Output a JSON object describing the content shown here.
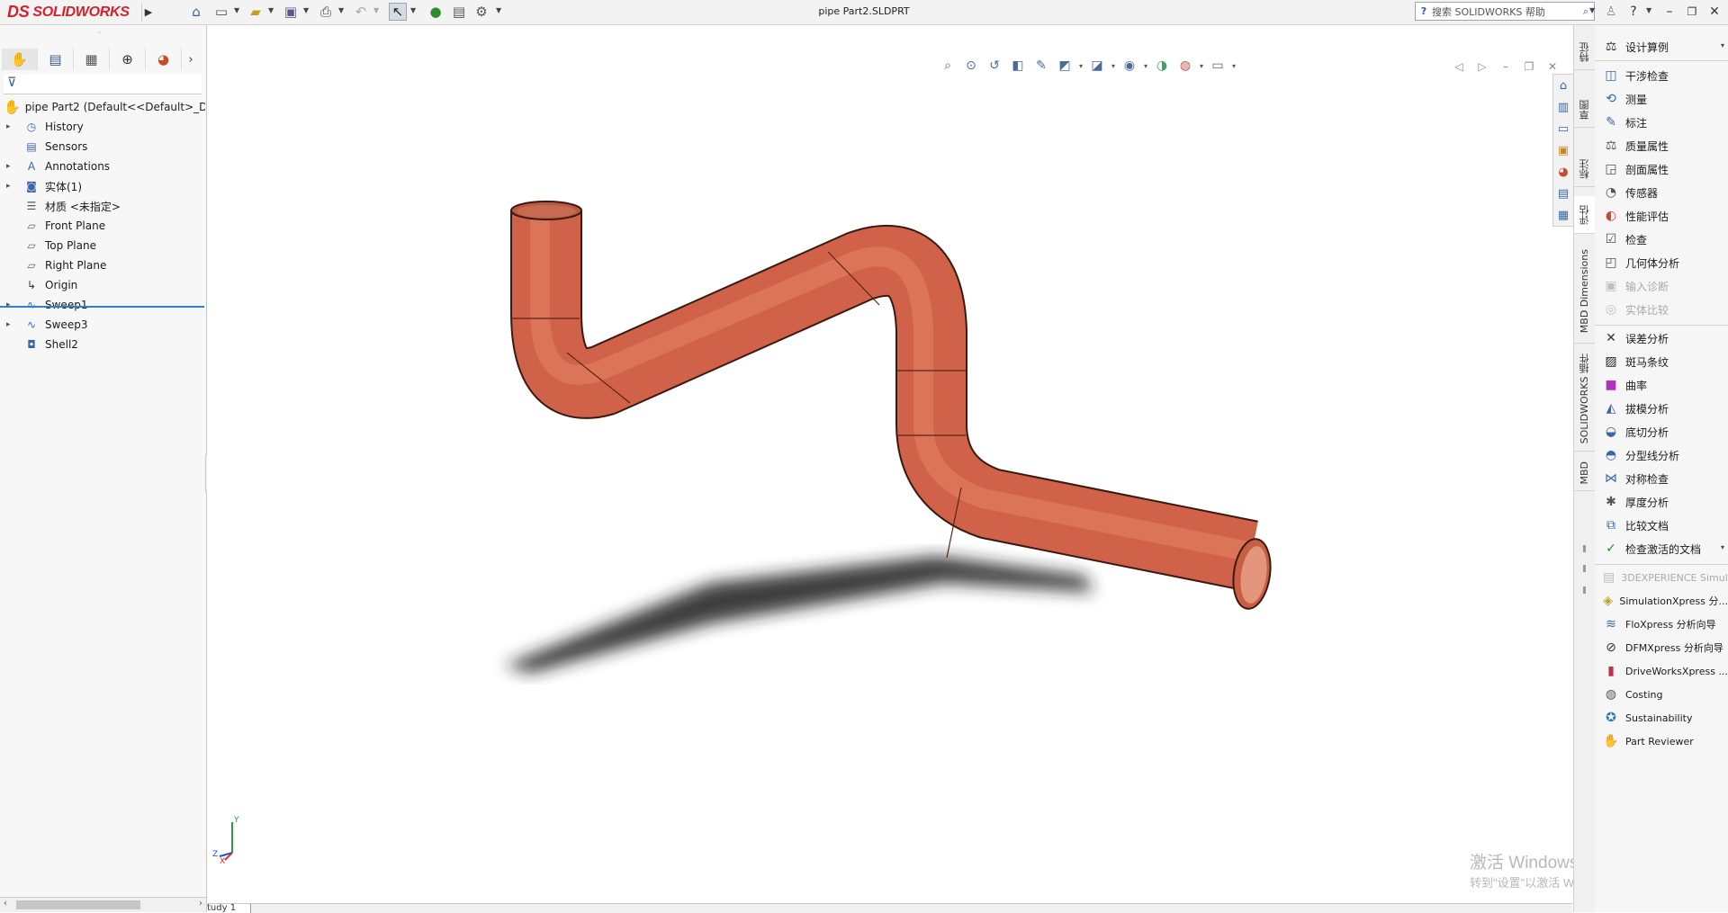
{
  "app": {
    "brand": "SOLIDWORKS",
    "brand_prefix": "DS",
    "document_title": "pipe Part2.SLDPRT",
    "help_search_placeholder": "搜索 SOLIDWORKS 帮助",
    "accent_color": "#d6202a",
    "pipe_color": "#d4674b"
  },
  "toolbar": {
    "icons": [
      "home-icon",
      "new-document-icon",
      "open-icon",
      "save-icon",
      "print-icon",
      "undo-icon",
      "select-icon",
      "rebuild-icon",
      "file-properties-icon",
      "options-icon"
    ]
  },
  "feature_tree": {
    "root_label": "pipe Part2  (Default<<Default>_Di",
    "items": [
      {
        "label": "History",
        "icon": "history-icon",
        "expandable": true
      },
      {
        "label": "Sensors",
        "icon": "sensors-icon",
        "expandable": false
      },
      {
        "label": "Annotations",
        "icon": "annotations-icon",
        "expandable": true
      },
      {
        "label": "实体(1)",
        "icon": "solid-bodies-icon",
        "expandable": true
      },
      {
        "label": "材质 <未指定>",
        "icon": "material-icon",
        "expandable": false
      },
      {
        "label": "Front Plane",
        "icon": "plane-icon",
        "expandable": false
      },
      {
        "label": "Top Plane",
        "icon": "plane-icon",
        "expandable": false
      },
      {
        "label": "Right Plane",
        "icon": "plane-icon",
        "expandable": false
      },
      {
        "label": "Origin",
        "icon": "origin-icon",
        "expandable": false
      },
      {
        "label": "Sweep1",
        "icon": "sweep-icon",
        "expandable": true
      },
      {
        "label": "Sweep3",
        "icon": "sweep-icon",
        "expandable": true
      },
      {
        "label": "Shell2",
        "icon": "shell-icon",
        "expandable": false
      }
    ]
  },
  "vertical_tabs": [
    {
      "label": "特征"
    },
    {
      "label": "草图"
    },
    {
      "label": "标注"
    },
    {
      "label": "评估",
      "active": true
    },
    {
      "label": "MBD Dimensions"
    },
    {
      "label": "SOLIDWORKS 插件"
    },
    {
      "label": "MBD"
    }
  ],
  "evaluate_panel": {
    "items": [
      {
        "label": "设计算例",
        "icon": "design-study-icon",
        "dropdown": true
      },
      {
        "label": "干涉检查",
        "icon": "interference-check-icon"
      },
      {
        "label": "测量",
        "icon": "measure-icon"
      },
      {
        "label": "标注",
        "icon": "markup-icon"
      },
      {
        "label": "质量属性",
        "icon": "mass-properties-icon"
      },
      {
        "label": "剖面属性",
        "icon": "section-properties-icon"
      },
      {
        "label": "传感器",
        "icon": "sensor-icon"
      },
      {
        "label": "性能评估",
        "icon": "performance-evaluation-icon"
      },
      {
        "label": "检查",
        "icon": "check-icon"
      },
      {
        "label": "几何体分析",
        "icon": "geometry-analysis-icon"
      },
      {
        "label": "输入诊断",
        "icon": "import-diagnostics-icon",
        "disabled": true
      },
      {
        "label": "实体比较",
        "icon": "compare-bodies-icon",
        "disabled": true
      },
      {
        "label": "误差分析",
        "icon": "deviation-analysis-icon"
      },
      {
        "label": "斑马条纹",
        "icon": "zebra-stripes-icon"
      },
      {
        "label": "曲率",
        "icon": "curvature-icon"
      },
      {
        "label": "拔模分析",
        "icon": "draft-analysis-icon"
      },
      {
        "label": "底切分析",
        "icon": "undercut-analysis-icon"
      },
      {
        "label": "分型线分析",
        "icon": "parting-line-analysis-icon"
      },
      {
        "label": "对称检查",
        "icon": "symmetry-check-icon"
      },
      {
        "label": "厚度分析",
        "icon": "thickness-analysis-icon"
      },
      {
        "label": "比较文档",
        "icon": "compare-documents-icon"
      },
      {
        "label": "检查激活的文档",
        "icon": "check-active-document-icon",
        "dropdown": true
      },
      {
        "label": "3DEXPERIENCE Simul...",
        "icon": "3dexperience-icon",
        "disabled": true
      },
      {
        "label": "SimulationXpress 分...",
        "icon": "simulationxpress-icon"
      },
      {
        "label": "FloXpress 分析向导",
        "icon": "floxpress-icon"
      },
      {
        "label": "DFMXpress 分析向导",
        "icon": "dfmxpress-icon"
      },
      {
        "label": "DriveWorksXpress ...",
        "icon": "driveworksxpress-icon"
      },
      {
        "label": "Costing",
        "icon": "costing-icon"
      },
      {
        "label": "Sustainability",
        "icon": "sustainability-icon"
      },
      {
        "label": "Part Reviewer",
        "icon": "part-reviewer-icon"
      }
    ]
  },
  "watermark": {
    "line1": "激活 Windows",
    "line2": "转到\"设置\"以激活 Windows。"
  },
  "bottom_tab": {
    "label": "tudy 1"
  },
  "triad": {
    "x": "X",
    "y": "Y",
    "z": "Z"
  }
}
